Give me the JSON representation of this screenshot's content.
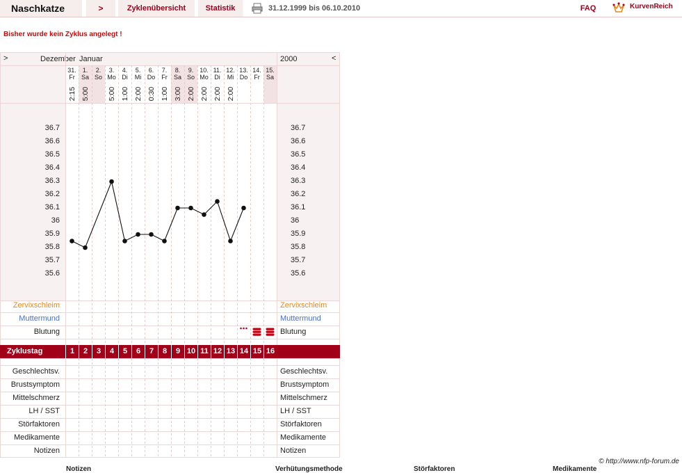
{
  "header": {
    "user_name": "Naschkatze",
    "nav_arrow": ">",
    "nav_cycles": "Zyklenübersicht",
    "nav_stats": "Statistik",
    "date_range": "31.12.1999 bis 06.10.2010",
    "faq": "FAQ",
    "brand": "KurvenReich"
  },
  "alert": "Bisher wurde kein Zyklus angelegt !",
  "chart": {
    "nav_left": ">",
    "nav_right": "<",
    "month_prev": "Dezember",
    "month_cur": "Januar",
    "year": "2000",
    "days": [
      {
        "d": "31.",
        "w": "Fr",
        "t": "2:15"
      },
      {
        "d": "1.",
        "w": "Sa",
        "t": "5:00"
      },
      {
        "d": "2.",
        "w": "So",
        "t": ""
      },
      {
        "d": "3.",
        "w": "Mo",
        "t": "5:00"
      },
      {
        "d": "4.",
        "w": "Di",
        "t": "1:00"
      },
      {
        "d": "5.",
        "w": "Mi",
        "t": "2:00"
      },
      {
        "d": "6.",
        "w": "Do",
        "t": "0:30"
      },
      {
        "d": "7.",
        "w": "Fr",
        "t": "1:00"
      },
      {
        "d": "8.",
        "w": "Sa",
        "t": "3:00"
      },
      {
        "d": "9.",
        "w": "So",
        "t": "2:00"
      },
      {
        "d": "10.",
        "w": "Mo",
        "t": "2:00"
      },
      {
        "d": "11.",
        "w": "Di",
        "t": "2:00"
      },
      {
        "d": "12.",
        "w": "Mi",
        "t": "2:00"
      },
      {
        "d": "13.",
        "w": "Do",
        "t": ""
      },
      {
        "d": "14.",
        "w": "Fr",
        "t": ""
      },
      {
        "d": "15.",
        "w": "Sa",
        "t": ""
      }
    ],
    "ticks": [
      "36.7",
      "36.6",
      "36.5",
      "36.4",
      "36.3",
      "36.2",
      "36.1",
      "36",
      "35.9",
      "35.8",
      "35.7",
      "35.6"
    ],
    "temps": [
      35.85,
      35.8,
      null,
      36.3,
      35.85,
      35.9,
      35.9,
      35.85,
      36.1,
      36.1,
      36.05,
      36.15,
      35.85,
      36.1,
      null,
      null
    ],
    "rows_top": [
      "Zervixschleim",
      "Muttermund",
      "Blutung"
    ],
    "row_colors": {
      "Zervixschleim": "#e8871e",
      "Muttermund": "#4a6ec8",
      "Blutung": "#222222"
    },
    "blutung_marks": [
      "",
      "",
      "",
      "",
      "",
      "",
      "",
      "",
      "",
      "",
      "",
      "",
      "",
      "spotting",
      "heavy",
      "heavy"
    ],
    "zyklustag_label": "Zyklustag",
    "zyklustag_nums": [
      "1",
      "2",
      "3",
      "4",
      "5",
      "6",
      "7",
      "8",
      "9",
      "10",
      "11",
      "12",
      "13",
      "14",
      "15",
      "16"
    ],
    "rows_bottom": [
      "Geschlechtsv.",
      "Brustsymptom",
      "Mittelschmerz",
      "LH / SST",
      "Störfaktoren",
      "Medikamente",
      "Notizen"
    ]
  },
  "footer": {
    "credit": "© http://www.nfp-forum.de",
    "bottom_headers": [
      "Notizen",
      "Verhütungsmethode",
      "Störfaktoren",
      "Medikamente"
    ]
  },
  "colors": {
    "accent": "#a00018",
    "alert": "#e00000",
    "grid_bg": "#f8f1f1"
  }
}
